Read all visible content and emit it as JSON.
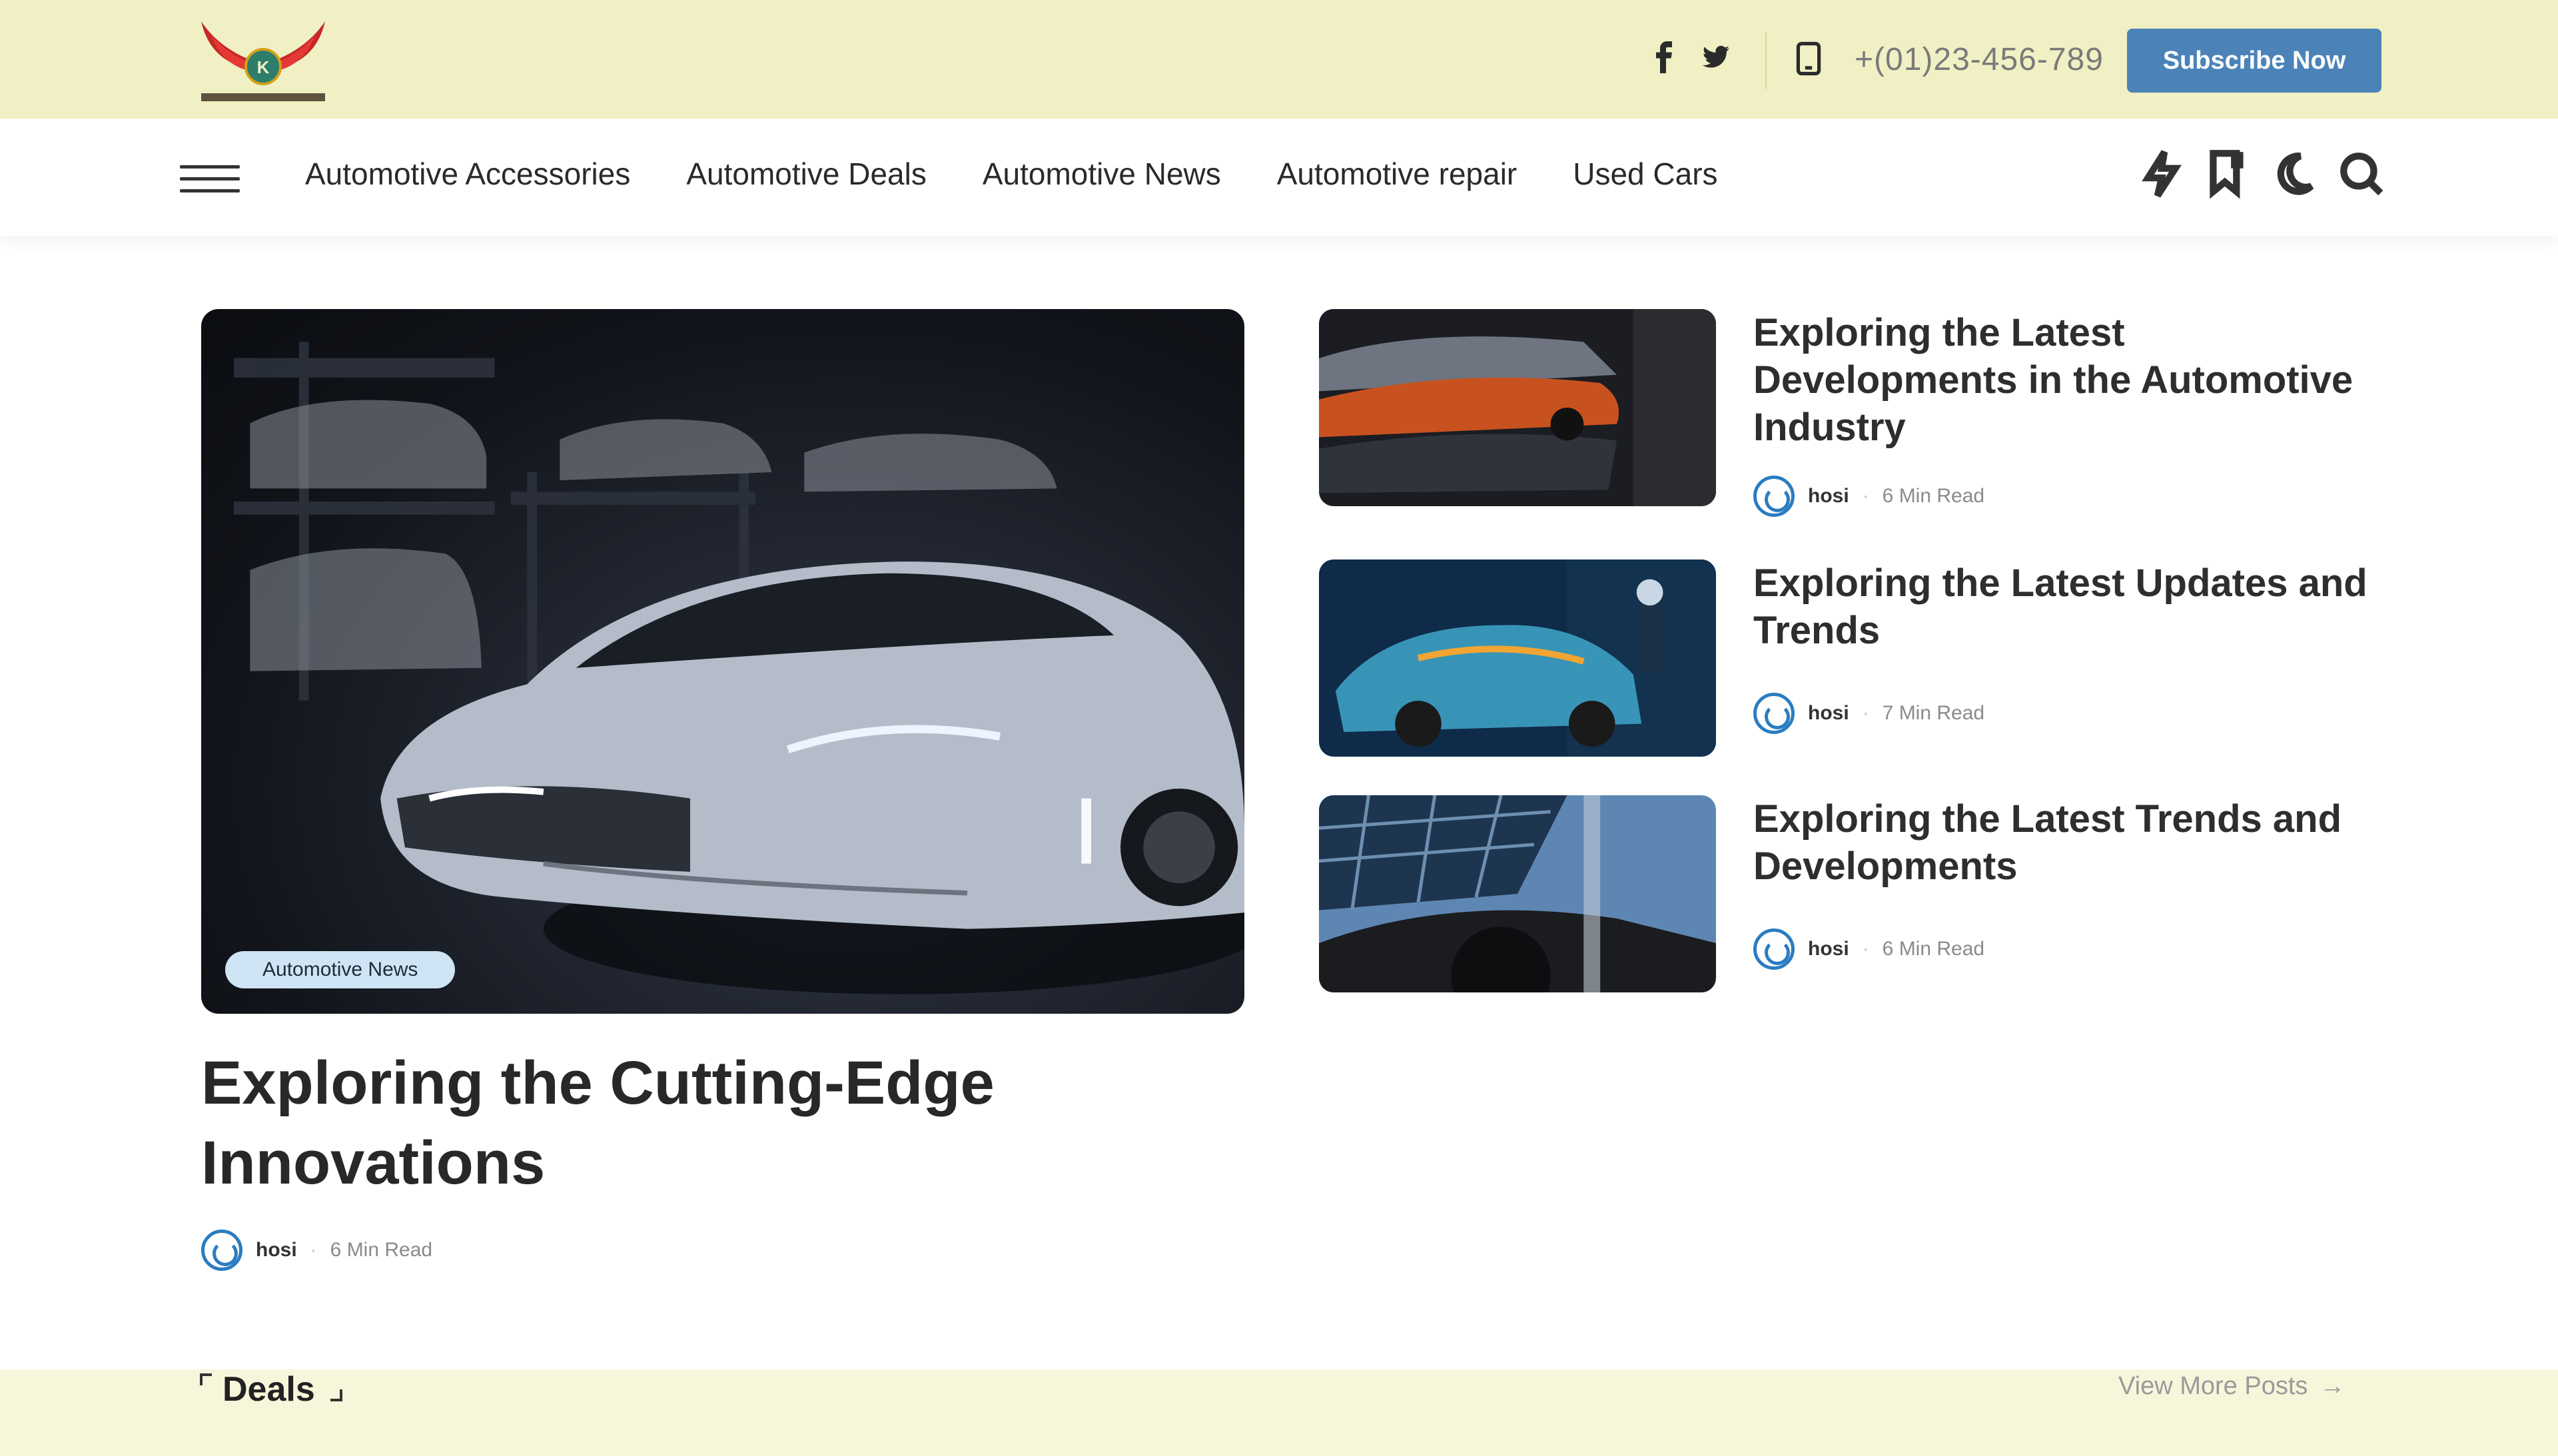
{
  "header": {
    "phone": "+(01)23-456-789",
    "subscribe_label": "Subscribe Now",
    "social": [
      "facebook-icon",
      "twitter-icon"
    ]
  },
  "nav": {
    "items": [
      {
        "label": "Automotive Accessories"
      },
      {
        "label": "Automotive Deals"
      },
      {
        "label": "Automotive News"
      },
      {
        "label": "Automotive repair"
      },
      {
        "label": "Used Cars"
      }
    ],
    "icons": [
      "lightning-icon",
      "bookmark-icon",
      "moon-icon",
      "search-icon"
    ]
  },
  "featured": {
    "category": "Automotive News",
    "title": "Exploring the Cutting-Edge Innovations",
    "author": "hosi",
    "read_time": "6 Min Read"
  },
  "side_posts": [
    {
      "title": "Exploring the Latest Developments in the Automotive Industry",
      "author": "hosi",
      "read_time": "6 Min Read"
    },
    {
      "title": "Exploring the Latest Updates and Trends",
      "author": "hosi",
      "read_time": "7 Min Read"
    },
    {
      "title": "Exploring the Latest Trends and Developments",
      "author": "hosi",
      "read_time": "6 Min Read"
    }
  ],
  "deals": {
    "title": "Deals",
    "view_more": "View More Posts"
  },
  "colors": {
    "topbar": "#f0f0c4",
    "subscribe": "#4b83b8",
    "accent": "#2b7cc1",
    "deals_bar": "#f7f6db"
  }
}
